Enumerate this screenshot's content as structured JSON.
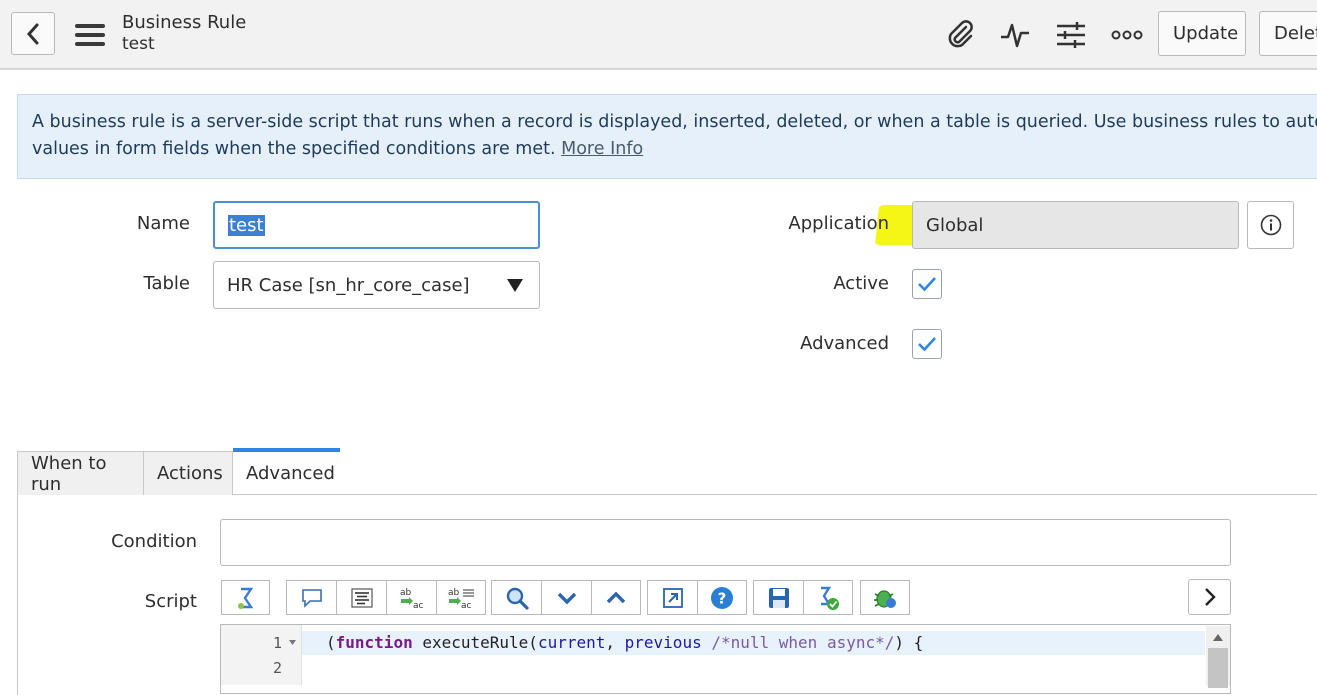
{
  "header": {
    "title": "Business Rule",
    "subtitle": "test",
    "update_label": "Update",
    "delete_label": "Delet",
    "icons": [
      "back-icon",
      "menu-icon",
      "paperclip-icon",
      "activity-icon",
      "settings-sliders-icon",
      "more-icon"
    ]
  },
  "info": {
    "text": "A business rule is a server-side script that runs when a record is displayed, inserted, deleted, or when a table is queried. Use business rules to automatically cha",
    "text2": "values in form fields when the specified conditions are met.",
    "more_link": "More Info"
  },
  "form": {
    "name_label": "Name",
    "name_value": "test",
    "table_label": "Table",
    "table_value": "HR Case [sn_hr_core_case]",
    "application_label": "Application",
    "application_value": "Global",
    "active_label": "Active",
    "active_checked": true,
    "advanced_label": "Advanced",
    "advanced_checked": true,
    "highlight_color": "#f4f40a",
    "accent_color": "#2d87e0"
  },
  "tabs": [
    {
      "label": "When to run",
      "active": false
    },
    {
      "label": "Actions",
      "active": false
    },
    {
      "label": "Advanced",
      "active": true
    }
  ],
  "advanced": {
    "condition_label": "Condition",
    "condition_value": "",
    "script_label": "Script",
    "line_numbers": [
      "1",
      "2"
    ],
    "code_line_1_parts": [
      "(",
      "function",
      " executeRule(",
      "current",
      ", ",
      "previous",
      " ",
      "/*null when async*/",
      ") {"
    ]
  }
}
